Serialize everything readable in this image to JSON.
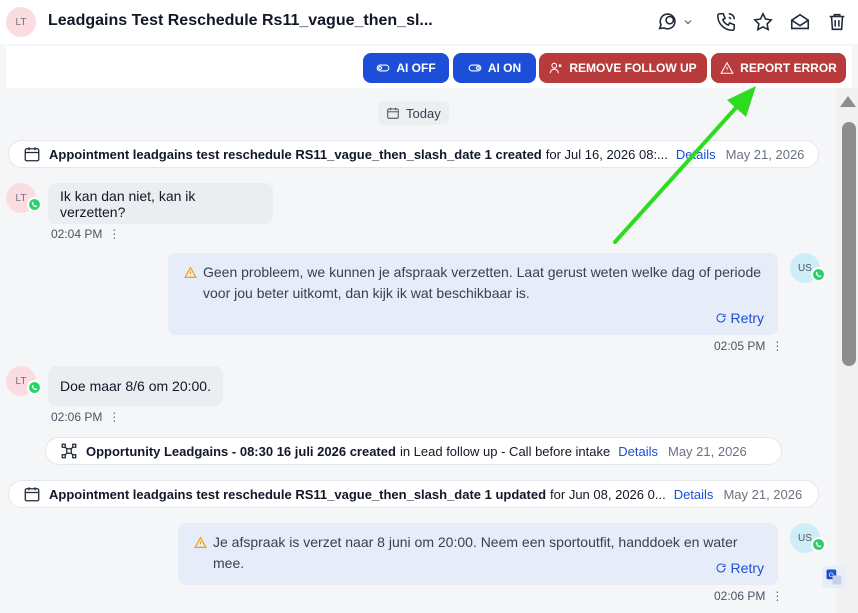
{
  "header": {
    "avatar_initials": "LT",
    "title": "Leadgains Test Reschedule Rs11_vague_then_sl...",
    "icons": [
      "chat-dropdown-icon",
      "phone-icon",
      "star-icon",
      "mail-icon",
      "trash-icon"
    ]
  },
  "actions": {
    "ai_off": "AI OFF",
    "ai_on": "AI ON",
    "remove_follow_up": "REMOVE FOLLOW UP",
    "report_error": "REPORT ERROR",
    "colors": {
      "blue": "#1d4ed8",
      "red": "#b83a3a"
    }
  },
  "thread": {
    "day_label": "Today",
    "event1": {
      "bold": "Appointment leadgains test reschedule RS11_vague_then_slash_date 1 created",
      "rest": "for Jul 16, 2026 08:...",
      "details": "Details",
      "date": "May 21, 2026"
    },
    "msg1": {
      "avatar": "LT",
      "text": "Ik kan dan niet, kan ik verzetten?",
      "time": "02:04 PM"
    },
    "msg2": {
      "avatar": "US",
      "text": "Geen probleem, we kunnen je afspraak verzetten. Laat gerust weten welke dag of periode voor jou beter uitkomt, dan kijk ik wat beschikbaar is.",
      "retry": "Retry",
      "time": "02:05 PM"
    },
    "msg3": {
      "avatar": "LT",
      "text": "Doe maar 8/6 om 20:00.",
      "time": "02:06 PM"
    },
    "event2": {
      "bold": "Opportunity Leadgains - 08:30 16 juli 2026 created",
      "rest": "in Lead follow up - Call before intake",
      "details": "Details",
      "date": "May 21, 2026"
    },
    "event3": {
      "bold": "Appointment leadgains test reschedule RS11_vague_then_slash_date 1 updated",
      "rest": "for Jun 08, 2026 0...",
      "details": "Details",
      "date": "May 21, 2026"
    },
    "msg4": {
      "avatar": "US",
      "text": "Je afspraak is verzet naar 8 juni om 20:00. Neem een sportoutfit, handdoek en water mee.",
      "retry": "Retry",
      "time": "02:06 PM"
    }
  },
  "dots": "⋮"
}
